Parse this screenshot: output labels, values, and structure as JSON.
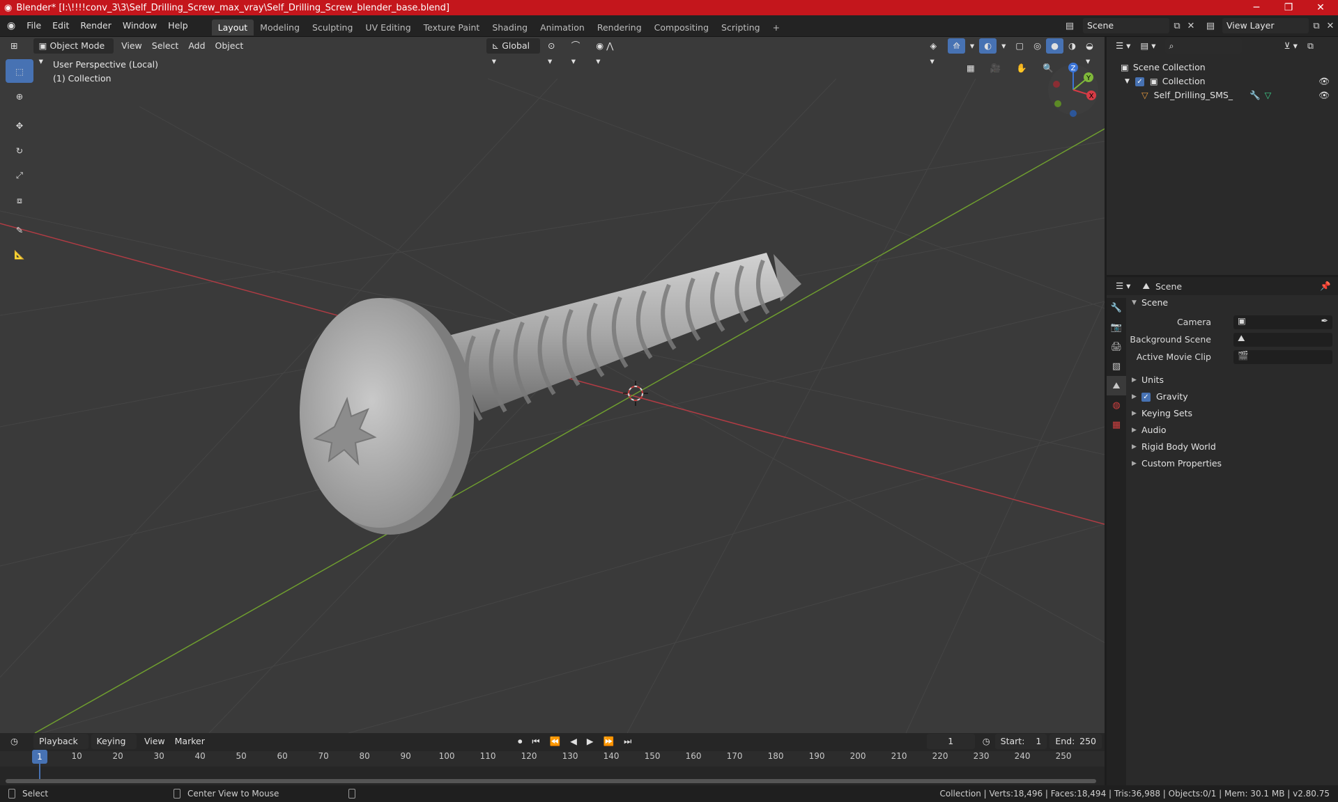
{
  "window": {
    "title": "Blender* [I:\\!!!!conv_3\\3\\Self_Drilling_Screw_max_vray\\Self_Drilling_Screw_blender_base.blend]",
    "minimize": "─",
    "maximize": "❐",
    "close": "✕"
  },
  "menus": [
    "File",
    "Edit",
    "Render",
    "Window",
    "Help"
  ],
  "workspaces": [
    "Layout",
    "Modeling",
    "Sculpting",
    "UV Editing",
    "Texture Paint",
    "Shading",
    "Animation",
    "Rendering",
    "Compositing",
    "Scripting"
  ],
  "workspace_add": "+",
  "scene_field": "Scene",
  "viewlayer_field": "View Layer",
  "viewport": {
    "mode": "Object Mode",
    "menus": [
      "View",
      "Select",
      "Add",
      "Object"
    ],
    "transform_orientation": "Global",
    "perspective_label": "User Perspective (Local)",
    "collection_label": "(1) Collection",
    "gizmo": {
      "z": "Z",
      "y": "Y",
      "x": "X"
    }
  },
  "outliner": {
    "scene_collection": "Scene Collection",
    "collection": "Collection",
    "object": "Self_Drilling_SMS_"
  },
  "properties": {
    "context": "Scene",
    "panel": "Scene",
    "camera_label": "Camera",
    "background_scene_label": "Background Scene",
    "active_movie_clip_label": "Active Movie Clip",
    "subpanels": [
      "Units",
      "Gravity",
      "Keying Sets",
      "Audio",
      "Rigid Body World",
      "Custom Properties"
    ]
  },
  "timeline": {
    "menus": [
      "Playback",
      "Keying",
      "View",
      "Marker"
    ],
    "current_frame": "1",
    "start_label": "Start:",
    "start": "1",
    "end_label": "End:",
    "end": "250",
    "ticks": [
      "10",
      "20",
      "30",
      "40",
      "50",
      "60",
      "70",
      "80",
      "90",
      "100",
      "110",
      "120",
      "130",
      "140",
      "150",
      "160",
      "170",
      "180",
      "190",
      "200",
      "210",
      "220",
      "230",
      "240",
      "250"
    ],
    "tick_frames": [
      10,
      20,
      30,
      40,
      50,
      60,
      70,
      80,
      90,
      100,
      110,
      120,
      130,
      140,
      150,
      160,
      170,
      180,
      190,
      200,
      210,
      220,
      230,
      240,
      250
    ]
  },
  "statusbar": {
    "select": "Select",
    "center_view": "Center View to Mouse",
    "stats": "Collection | Verts:18,496 | Faces:18,494 | Tris:36,988 | Objects:0/1 | Mem: 30.1 MB | v2.80.75"
  },
  "colors": {
    "accent": "#4772b3",
    "titlebar": "#c4161c",
    "x_axis": "#d63b45",
    "y_axis": "#7fb83a",
    "z_axis": "#3b74d6"
  }
}
